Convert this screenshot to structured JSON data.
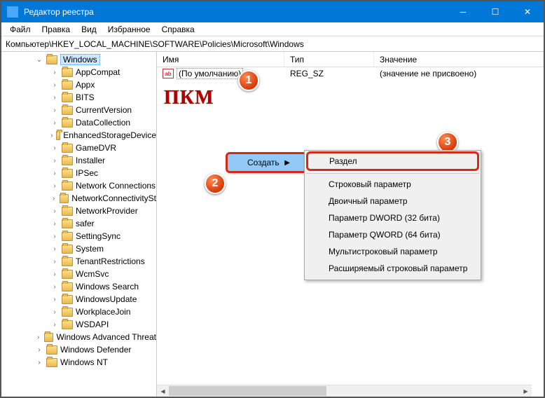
{
  "title": "Редактор реестра",
  "menu": {
    "file": "Файл",
    "edit": "Правка",
    "view": "Вид",
    "fav": "Избранное",
    "help": "Справка"
  },
  "address": "Компьютер\\HKEY_LOCAL_MACHINE\\SOFTWARE\\Policies\\Microsoft\\Windows",
  "cols": {
    "name": "Имя",
    "type": "Тип",
    "value": "Значение"
  },
  "row": {
    "name": "(По умолчанию)",
    "type": "REG_SZ",
    "value": "(значение не присвоено)"
  },
  "pkm": "ПКМ",
  "tree": {
    "selected": "Windows",
    "items": [
      "AppCompat",
      "Appx",
      "BITS",
      "CurrentVersion",
      "DataCollection",
      "EnhancedStorageDevice",
      "GameDVR",
      "Installer",
      "IPSec",
      "Network Connections",
      "NetworkConnectivitySt",
      "NetworkProvider",
      "safer",
      "SettingSync",
      "System",
      "TenantRestrictions",
      "WcmSvc",
      "Windows Search",
      "WindowsUpdate",
      "WorkplaceJoin",
      "WSDAPI"
    ],
    "after": [
      "Windows Advanced Threat",
      "Windows Defender",
      "Windows NT"
    ]
  },
  "ctx1": {
    "create": "Создать"
  },
  "ctx2": {
    "items": [
      "Раздел",
      "Строковый параметр",
      "Двоичный параметр",
      "Параметр DWORD (32 бита)",
      "Параметр QWORD (64 бита)",
      "Мультистроковый параметр",
      "Расширяемый строковый параметр"
    ]
  },
  "badges": {
    "b1": "1",
    "b2": "2",
    "b3": "3"
  }
}
